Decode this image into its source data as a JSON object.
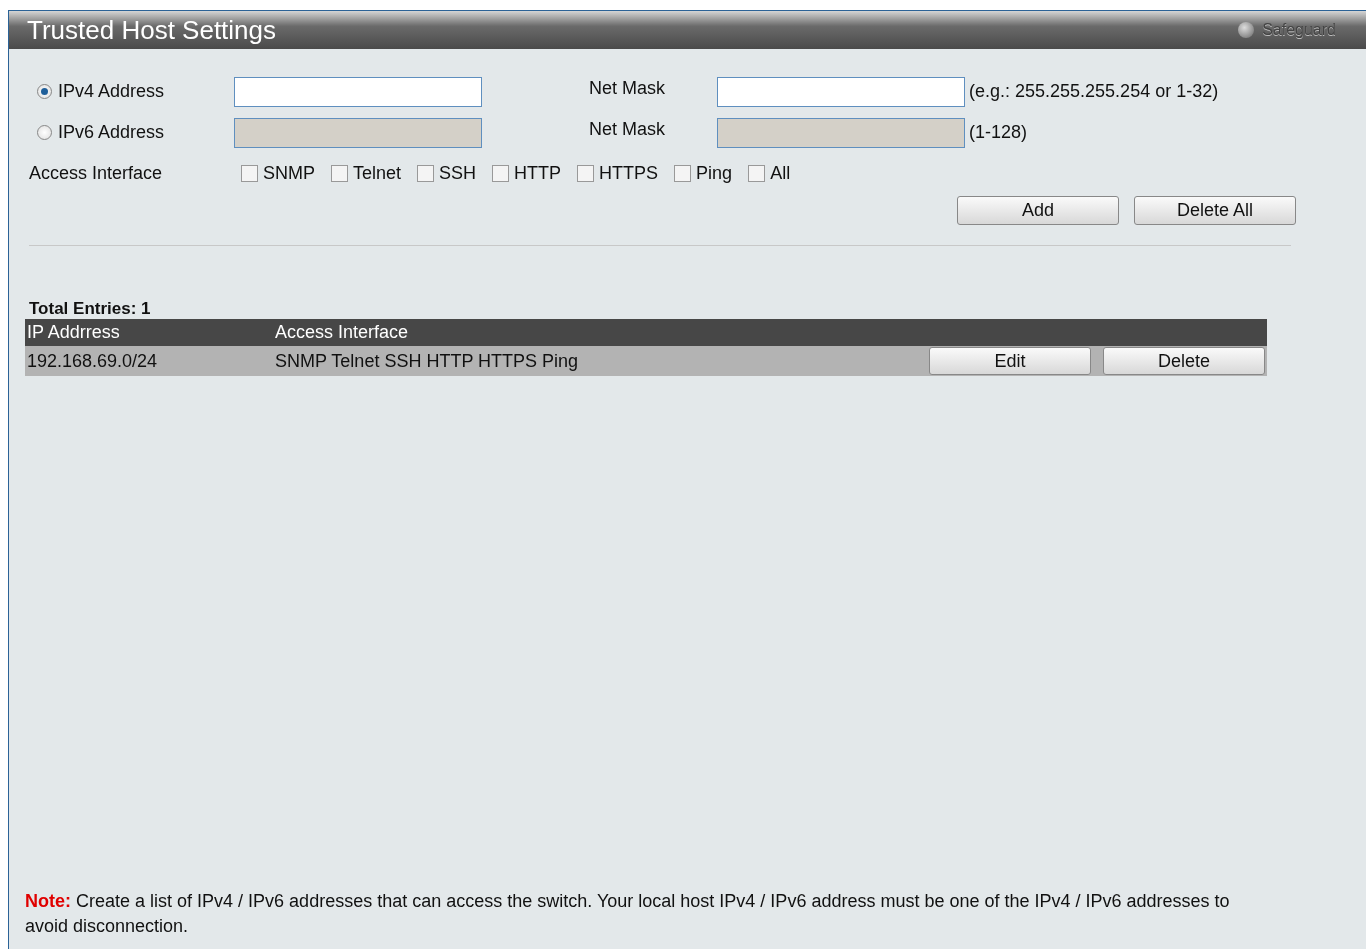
{
  "header": {
    "title": "Trusted Host Settings",
    "safeguard": "Safeguard"
  },
  "address_rows": [
    {
      "label": "IPv4 Address",
      "selected": true,
      "address_disabled": false,
      "mask_label": "Net Mask",
      "mask_disabled": false,
      "hint": "(e.g.: 255.255.255.254 or 1-32)"
    },
    {
      "label": "IPv6 Address",
      "selected": false,
      "address_disabled": true,
      "mask_label": "Net Mask",
      "mask_disabled": true,
      "hint": "(1-128)"
    }
  ],
  "access_interface": {
    "label": "Access Interface",
    "options": [
      {
        "label": "SNMP",
        "checked": false
      },
      {
        "label": "Telnet",
        "checked": false
      },
      {
        "label": "SSH",
        "checked": false
      },
      {
        "label": "HTTP",
        "checked": false
      },
      {
        "label": "HTTPS",
        "checked": false
      },
      {
        "label": "Ping",
        "checked": false
      },
      {
        "label": "All",
        "checked": false
      }
    ]
  },
  "buttons": [
    "Add",
    "Delete All"
  ],
  "total_entries": "Total Entries: 1",
  "table": {
    "columns": [
      "IP Addrress",
      "Access Interface"
    ],
    "rows": [
      {
        "ip": "192.168.69.0/24",
        "access": "SNMP Telnet SSH HTTP HTTPS Ping",
        "actions": [
          "Edit",
          "Delete"
        ]
      }
    ]
  },
  "note": {
    "label": "Note:",
    "text": "Create a list of IPv4 / IPv6 addresses that can access the switch. Your local host IPv4 / IPv6 address must be one of the IPv4 / IPv6 addresses to avoid disconnection."
  }
}
